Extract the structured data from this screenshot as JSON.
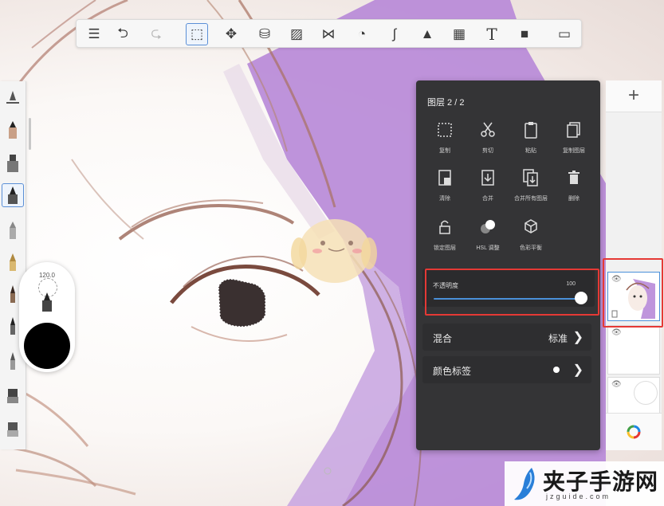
{
  "toolbar": {
    "tools": [
      {
        "name": "list-icon",
        "glyph": "☰"
      },
      {
        "name": "undo-icon",
        "glyph": "⮌"
      },
      {
        "name": "redo-icon",
        "glyph": "⮎"
      },
      {
        "name": "selection-icon",
        "glyph": "⬚"
      },
      {
        "name": "move-icon",
        "glyph": "✥"
      },
      {
        "name": "fill-bucket-icon",
        "glyph": "⛁"
      },
      {
        "name": "ruler-icon",
        "glyph": "▨"
      },
      {
        "name": "symmetry-icon",
        "glyph": "⋈"
      },
      {
        "name": "shape-icon",
        "glyph": "◔"
      },
      {
        "name": "curve-icon",
        "glyph": "∫"
      },
      {
        "name": "image-insert-icon",
        "glyph": "▲"
      },
      {
        "name": "perspective-icon",
        "glyph": "▦"
      },
      {
        "name": "text-icon",
        "glyph": "T"
      },
      {
        "name": "record-icon",
        "glyph": "■"
      },
      {
        "name": "fullscreen-icon",
        "glyph": "▭"
      }
    ]
  },
  "brush": {
    "size": "120.0",
    "color": "#000000"
  },
  "layer_panel": {
    "title": "图层 2 / 2",
    "actions": [
      {
        "label": "复制",
        "icon": "copy-selection-icon"
      },
      {
        "label": "剪切",
        "icon": "scissors-icon"
      },
      {
        "label": "粘贴",
        "icon": "paste-icon"
      },
      {
        "label": "复制图层",
        "icon": "duplicate-layer-icon"
      },
      {
        "label": "清除",
        "icon": "clear-icon"
      },
      {
        "label": "合并",
        "icon": "merge-icon"
      },
      {
        "label": "合并所有图层",
        "icon": "merge-all-icon"
      },
      {
        "label": "删除",
        "icon": "trash-icon"
      },
      {
        "label": "锁定图层",
        "icon": "lock-icon"
      },
      {
        "label": "HSL 调整",
        "icon": "hsl-icon"
      },
      {
        "label": "色彩平衡",
        "icon": "color-balance-icon"
      }
    ],
    "opacity": {
      "label": "不透明度",
      "value": "100",
      "fraction": 1.0
    },
    "blend": {
      "label": "混合",
      "value": "标准"
    },
    "color_tag": {
      "label": "颜色标签"
    }
  },
  "layers_column": {
    "add": "+",
    "eye": "👁"
  },
  "colors": {
    "accent": "#4a90d9",
    "highlight": "#e53935",
    "panel": "#343436",
    "hair_purple": "#b88ad8"
  },
  "watermark": {
    "title": "夹子手游网",
    "url": "jzguide.com"
  }
}
